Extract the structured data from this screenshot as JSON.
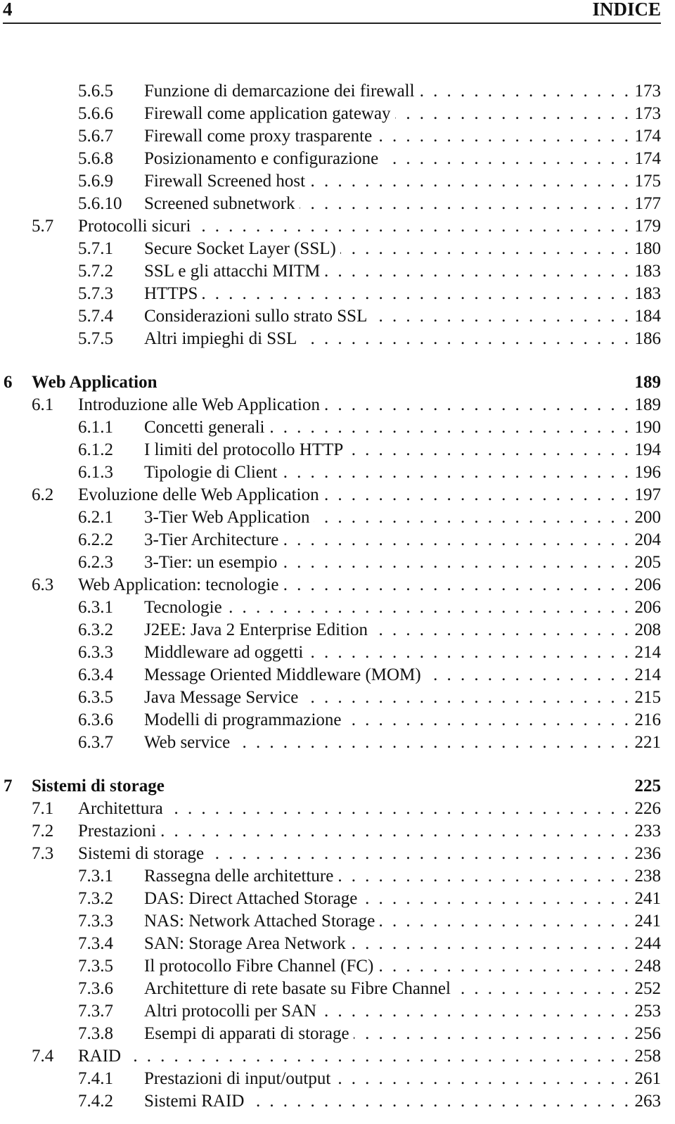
{
  "header": {
    "page_number": "4",
    "running_title": "INDICE"
  },
  "toc": [
    {
      "level": 2,
      "number": "5.6.5",
      "title": "Funzione di demarcazione dei firewall",
      "page": "173"
    },
    {
      "level": 2,
      "number": "5.6.6",
      "title": "Firewall come application gateway",
      "page": "173"
    },
    {
      "level": 2,
      "number": "5.6.7",
      "title": "Firewall come proxy trasparente",
      "page": "174"
    },
    {
      "level": 2,
      "number": "5.6.8",
      "title": "Posizionamento e configurazione",
      "page": "174"
    },
    {
      "level": 2,
      "number": "5.6.9",
      "title": "Firewall Screened host",
      "page": "175"
    },
    {
      "level": 2,
      "number": "5.6.10",
      "title": "Screened subnetwork",
      "page": "177"
    },
    {
      "level": 1,
      "number": "5.7",
      "title": "Protocolli sicuri",
      "page": "179"
    },
    {
      "level": 2,
      "number": "5.7.1",
      "title": "Secure Socket Layer (SSL)",
      "page": "180"
    },
    {
      "level": 2,
      "number": "5.7.2",
      "title": "SSL e gli attacchi MITM",
      "page": "183"
    },
    {
      "level": 2,
      "number": "5.7.3",
      "title": "HTTPS",
      "page": "183"
    },
    {
      "level": 2,
      "number": "5.7.4",
      "title": "Considerazioni sullo strato SSL",
      "page": "184"
    },
    {
      "level": 2,
      "number": "5.7.5",
      "title": "Altri impieghi di SSL",
      "page": "186"
    },
    {
      "level": 0,
      "number": "6",
      "title": "Web Application",
      "page": "189"
    },
    {
      "level": 1,
      "number": "6.1",
      "title": "Introduzione alle Web Application",
      "page": "189"
    },
    {
      "level": 2,
      "number": "6.1.1",
      "title": "Concetti generali",
      "page": "190"
    },
    {
      "level": 2,
      "number": "6.1.2",
      "title": "I limiti del protocollo HTTP",
      "page": "194"
    },
    {
      "level": 2,
      "number": "6.1.3",
      "title": "Tipologie di Client",
      "page": "196"
    },
    {
      "level": 1,
      "number": "6.2",
      "title": "Evoluzione delle Web Application",
      "page": "197"
    },
    {
      "level": 2,
      "number": "6.2.1",
      "title": "3-Tier Web Application",
      "page": "200"
    },
    {
      "level": 2,
      "number": "6.2.2",
      "title": "3-Tier Architecture",
      "page": "204"
    },
    {
      "level": 2,
      "number": "6.2.3",
      "title": "3-Tier: un esempio",
      "page": "205"
    },
    {
      "level": 1,
      "number": "6.3",
      "title": "Web Application: tecnologie",
      "page": "206"
    },
    {
      "level": 2,
      "number": "6.3.1",
      "title": "Tecnologie",
      "page": "206"
    },
    {
      "level": 2,
      "number": "6.3.2",
      "title": "J2EE: Java 2 Enterprise Edition",
      "page": "208"
    },
    {
      "level": 2,
      "number": "6.3.3",
      "title": "Middleware ad oggetti",
      "page": "214"
    },
    {
      "level": 2,
      "number": "6.3.4",
      "title": "Message Oriented Middleware (MOM)",
      "page": "214"
    },
    {
      "level": 2,
      "number": "6.3.5",
      "title": "Java Message Service",
      "page": "215"
    },
    {
      "level": 2,
      "number": "6.3.6",
      "title": "Modelli di programmazione",
      "page": "216"
    },
    {
      "level": 2,
      "number": "6.3.7",
      "title": "Web service",
      "page": "221"
    },
    {
      "level": 0,
      "number": "7",
      "title": "Sistemi di storage",
      "page": "225"
    },
    {
      "level": 1,
      "number": "7.1",
      "title": "Architettura",
      "page": "226"
    },
    {
      "level": 1,
      "number": "7.2",
      "title": "Prestazioni",
      "page": "233"
    },
    {
      "level": 1,
      "number": "7.3",
      "title": "Sistemi di storage",
      "page": "236"
    },
    {
      "level": 2,
      "number": "7.3.1",
      "title": "Rassegna delle architetture",
      "page": "238"
    },
    {
      "level": 2,
      "number": "7.3.2",
      "title": "DAS: Direct Attached Storage",
      "page": "241"
    },
    {
      "level": 2,
      "number": "7.3.3",
      "title": "NAS: Network Attached Storage",
      "page": "241"
    },
    {
      "level": 2,
      "number": "7.3.4",
      "title": "SAN: Storage Area Network",
      "page": "244"
    },
    {
      "level": 2,
      "number": "7.3.5",
      "title": "Il protocollo Fibre Channel (FC)",
      "page": "248"
    },
    {
      "level": 2,
      "number": "7.3.6",
      "title": "Architetture di rete basate su Fibre Channel",
      "page": "252"
    },
    {
      "level": 2,
      "number": "7.3.7",
      "title": "Altri protocolli per SAN",
      "page": "253"
    },
    {
      "level": 2,
      "number": "7.3.8",
      "title": "Esempi di apparati di storage",
      "page": "256"
    },
    {
      "level": 1,
      "number": "7.4",
      "title": "RAID",
      "page": "258"
    },
    {
      "level": 2,
      "number": "7.4.1",
      "title": "Prestazioni di input/output",
      "page": "261"
    },
    {
      "level": 2,
      "number": "7.4.2",
      "title": "Sistemi RAID",
      "page": "263"
    }
  ]
}
